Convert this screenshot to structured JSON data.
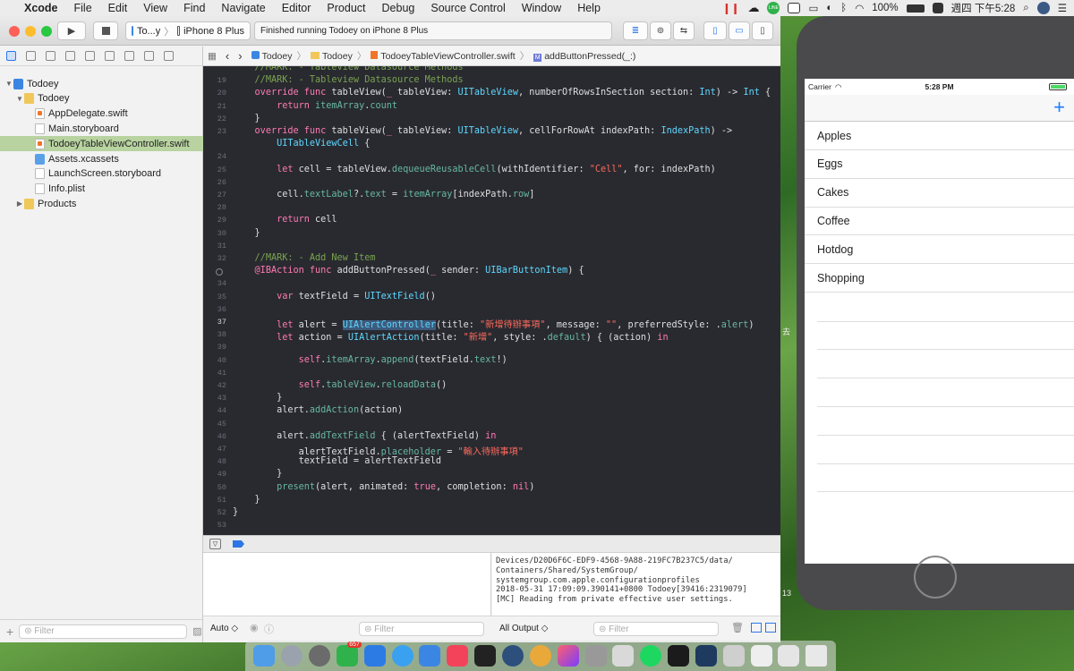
{
  "menubar": {
    "app": "Xcode",
    "items": [
      "File",
      "Edit",
      "View",
      "Find",
      "Navigate",
      "Editor",
      "Product",
      "Debug",
      "Source Control",
      "Window",
      "Help"
    ],
    "battery": "100%",
    "clock": "週四 下午5:28",
    "line_badge": "LINE"
  },
  "toolbar": {
    "scheme": "To...y",
    "device": "iPhone 8 Plus",
    "status": "Finished running Todoey on iPhone 8 Plus"
  },
  "navigator": {
    "rows": [
      {
        "label": "Todoey",
        "indent": 0,
        "icon": "proj",
        "disc": "▼"
      },
      {
        "label": "Todoey",
        "indent": 1,
        "icon": "folder",
        "disc": "▼"
      },
      {
        "label": "AppDelegate.swift",
        "indent": 2,
        "icon": "swift",
        "disc": ""
      },
      {
        "label": "Main.storyboard",
        "indent": 2,
        "icon": "sb",
        "disc": ""
      },
      {
        "label": "TodoeyTableViewController.swift",
        "indent": 2,
        "icon": "swift",
        "disc": "",
        "selected": true
      },
      {
        "label": "Assets.xcassets",
        "indent": 2,
        "icon": "xc",
        "disc": ""
      },
      {
        "label": "LaunchScreen.storyboard",
        "indent": 2,
        "icon": "sb",
        "disc": ""
      },
      {
        "label": "Info.plist",
        "indent": 2,
        "icon": "pl",
        "disc": ""
      },
      {
        "label": "Products",
        "indent": 1,
        "icon": "folder",
        "disc": "▶"
      }
    ],
    "filter_placeholder": "Filter"
  },
  "jumpbar": [
    "Todoey",
    "Todoey",
    "TodoeyTableViewController.swift",
    "addButtonPressed(_:)"
  ],
  "code": [
    {
      "n": "",
      "h": "    <span class=\"c\">//MARK: - Tableview Datasource Methods</span>",
      "partial": true
    },
    {
      "n": "19",
      "h": "    <span class=\"c\">//MARK: - Tableview Datasource Methods</span>"
    },
    {
      "n": "20",
      "h": "    <span class=\"k\">override func</span> tableView(<span class=\"k\">_</span> tableView: <span class=\"t\">UITableView</span>, numberOfRowsInSection section: <span class=\"t\">Int</span>) -&gt; <span class=\"t\">Int</span> {"
    },
    {
      "n": "21",
      "h": "        <span class=\"k\">return</span> <span class=\"f\">itemArray</span>.<span class=\"f\">count</span>"
    },
    {
      "n": "22",
      "h": "    }"
    },
    {
      "n": "23",
      "h": "    <span class=\"k\">override func</span> tableView(<span class=\"k\">_</span> tableView: <span class=\"t\">UITableView</span>, cellForRowAt indexPath: <span class=\"t\">IndexPath</span>) -&gt;"
    },
    {
      "n": "",
      "h": "        <span class=\"t\">UITableViewCell</span> {"
    },
    {
      "n": "24",
      "h": ""
    },
    {
      "n": "25",
      "h": "        <span class=\"k\">let</span> cell = tableView.<span class=\"f\">dequeueReusableCell</span>(withIdentifier: <span class=\"s\">\"Cell\"</span>, for: indexPath)"
    },
    {
      "n": "26",
      "h": ""
    },
    {
      "n": "27",
      "h": "        cell.<span class=\"f\">textLabel</span>?.<span class=\"f\">text</span> = <span class=\"f\">itemArray</span>[indexPath.<span class=\"f\">row</span>]"
    },
    {
      "n": "28",
      "h": ""
    },
    {
      "n": "29",
      "h": "        <span class=\"k\">return</span> cell"
    },
    {
      "n": "30",
      "h": "    }"
    },
    {
      "n": "31",
      "h": ""
    },
    {
      "n": "32",
      "h": "    <span class=\"c\">//MARK: - Add New Item</span>"
    },
    {
      "n": "",
      "h": "    <span class=\"k\">@IBAction func</span> addButtonPressed(<span class=\"k\">_</span> sender: <span class=\"t\">UIBarButtonItem</span>) {",
      "bp": true
    },
    {
      "n": "34",
      "h": ""
    },
    {
      "n": "35",
      "h": "        <span class=\"k\">var</span> textField = <span class=\"t\">UITextField</span>()"
    },
    {
      "n": "36",
      "h": ""
    },
    {
      "n": "37",
      "h": "        <span class=\"k\">let</span> alert = <span class=\"t hl\">UIAlertController</span>(title: <span class=\"s\">\"新增待辦事項\"</span>, message: <span class=\"s\">\"\"</span>, preferredStyle: .<span class=\"f\">alert</span>)",
      "cur": true
    },
    {
      "n": "38",
      "h": "        <span class=\"k\">let</span> action = <span class=\"t\">UIAlertAction</span>(title: <span class=\"s\">\"新增\"</span>, style: .<span class=\"f\">default</span>) { (action) <span class=\"k\">in</span>"
    },
    {
      "n": "39",
      "h": ""
    },
    {
      "n": "40",
      "h": "            <span class=\"k\">self</span>.<span class=\"f\">itemArray</span>.<span class=\"f\">append</span>(textField.<span class=\"f\">text</span>!)"
    },
    {
      "n": "41",
      "h": ""
    },
    {
      "n": "42",
      "h": "            <span class=\"k\">self</span>.<span class=\"f\">tableView</span>.<span class=\"f\">reloadData</span>()"
    },
    {
      "n": "43",
      "h": "        }"
    },
    {
      "n": "44",
      "h": "        alert.<span class=\"f\">addAction</span>(action)"
    },
    {
      "n": "45",
      "h": ""
    },
    {
      "n": "46",
      "h": "        alert.<span class=\"f\">addTextField</span> { (alertTextField) <span class=\"k\">in</span>"
    },
    {
      "n": "47",
      "h": "            alertTextField.<span class=\"f\">placeholder</span> = <span class=\"s\">\"輸入待辦事項\"</span>"
    },
    {
      "n": "48",
      "h": "            textField = alertTextField"
    },
    {
      "n": "49",
      "h": "        }"
    },
    {
      "n": "50",
      "h": "        <span class=\"f\">present</span>(alert, animated: <span class=\"k\">true</span>, completion: <span class=\"k\">nil</span>)"
    },
    {
      "n": "51",
      "h": "    }"
    },
    {
      "n": "52",
      "h": "}"
    },
    {
      "n": "53",
      "h": ""
    }
  ],
  "console": "Devices/D20D6F6C-EDF9-4568-9A88-219FC7B237C5/data/\nContainers/Shared/SystemGroup/\nsystemgroup.com.apple.configurationprofiles\n2018-05-31 17:09:09.390141+0800 Todoey[39416:2319079]\n[MC] Reading from private effective user settings.",
  "debug": {
    "auto": "Auto ◇",
    "all_output": "All Output ◇",
    "filter": "Filter"
  },
  "simulator": {
    "carrier": "Carrier",
    "time": "5:28 PM",
    "add": "+",
    "items": [
      "Apples",
      "Eggs",
      "Cakes",
      "Coffee",
      "Hotdog",
      "Shopping"
    ]
  },
  "dock": {
    "line_badge": "657"
  }
}
